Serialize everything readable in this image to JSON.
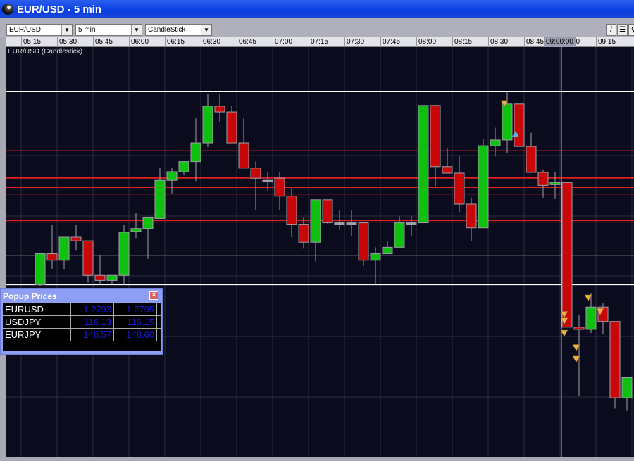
{
  "window": {
    "title": "EUR/USD - 5 min"
  },
  "toolbar": {
    "symbol": "EUR/USD",
    "interval": "5 min",
    "chart_type": "CandleStick",
    "tools": [
      "draw-line-icon",
      "horizontal-lines-icon",
      "zoom-icon"
    ]
  },
  "time_axis": {
    "ticks": [
      "05:15",
      "05:30",
      "05:45",
      "06:00",
      "06:15",
      "06:30",
      "06:45",
      "07:00",
      "07:15",
      "07:30",
      "07:45",
      "08:00",
      "08:15",
      "08:30",
      "08:45",
      "09:00",
      "09:15"
    ],
    "cursor_time": "09:00:00"
  },
  "chart": {
    "label": "EUR/USD (Candlestick)"
  },
  "popup": {
    "title": "Popup Prices",
    "rows": [
      {
        "symbol": "EURUSD",
        "bid": "1.2793",
        "ask": "1.2795"
      },
      {
        "symbol": "USDJPY",
        "bid": "116.13",
        "ask": "116.15"
      },
      {
        "symbol": "EURJPY",
        "bid": "148.57",
        "ask": "148.60"
      }
    ]
  },
  "colors": {
    "up": "#10c010",
    "down": "#c80808",
    "bg": "#0a0b1c",
    "level": "#e02020",
    "marker_sell": "#f0b040",
    "marker_buy": "#60b0f0"
  },
  "chart_data": {
    "type": "candlestick",
    "title": "EUR/USD (Candlestick)",
    "interval_minutes": 5,
    "first_candle_time": "05:20",
    "ylim": [
      -50,
      520
    ],
    "ohlc": [
      [
        190,
        233,
        233,
        188
      ],
      [
        233,
        224,
        273,
        212
      ],
      [
        224,
        256,
        256,
        212
      ],
      [
        256,
        251,
        273,
        238
      ],
      [
        251,
        203,
        251,
        193
      ],
      [
        203,
        196,
        231,
        190
      ],
      [
        196,
        203,
        203,
        190
      ],
      [
        203,
        263,
        273,
        190
      ],
      [
        264,
        268,
        290,
        255
      ],
      [
        268,
        283,
        283,
        226
      ],
      [
        282,
        335,
        352,
        282
      ],
      [
        335,
        347,
        352,
        317
      ],
      [
        347,
        361,
        361,
        343
      ],
      [
        361,
        387,
        421,
        334
      ],
      [
        387,
        438,
        455,
        381
      ],
      [
        438,
        430,
        455,
        416
      ],
      [
        430,
        387,
        438,
        387
      ],
      [
        387,
        352,
        421,
        352
      ],
      [
        352,
        338,
        361,
        294
      ],
      [
        335,
        335,
        347,
        321
      ],
      [
        338,
        313,
        347,
        294
      ],
      [
        313,
        274,
        324,
        256
      ],
      [
        274,
        249,
        283,
        240
      ],
      [
        249,
        308,
        308,
        222
      ],
      [
        308,
        276,
        308,
        275
      ],
      [
        276,
        276,
        294,
        266
      ],
      [
        276,
        276,
        294,
        258
      ],
      [
        276,
        224,
        276,
        216
      ],
      [
        224,
        233,
        242,
        190
      ],
      [
        233,
        242,
        251,
        233
      ],
      [
        242,
        276,
        285,
        242
      ],
      [
        276,
        276,
        285,
        258
      ],
      [
        276,
        439,
        439,
        276
      ],
      [
        439,
        354,
        439,
        327
      ],
      [
        354,
        345,
        380,
        345
      ],
      [
        345,
        302,
        369,
        291
      ],
      [
        302,
        269,
        311,
        251
      ],
      [
        269,
        383,
        392,
        269
      ],
      [
        383,
        391,
        408,
        368
      ],
      [
        391,
        441,
        457,
        373
      ],
      [
        441,
        382,
        441,
        382
      ],
      [
        382,
        346,
        401,
        346
      ],
      [
        346,
        328,
        350,
        311
      ],
      [
        329,
        332,
        346,
        309
      ],
      [
        332,
        131,
        332,
        131
      ],
      [
        131,
        128,
        148,
        36
      ],
      [
        128,
        159,
        178,
        123
      ],
      [
        159,
        139,
        164,
        122
      ],
      [
        139,
        33,
        139,
        18
      ],
      [
        33,
        61,
        61,
        15
      ]
    ],
    "levels": [
      {
        "value": 458,
        "color": "#ffffff"
      },
      {
        "value": 190,
        "color": "#ffffff"
      },
      {
        "value": 231,
        "color": "#b8b8c8"
      },
      {
        "value": 376,
        "color": "#e02020"
      },
      {
        "value": 339,
        "color": "#e02020"
      },
      {
        "value": 338,
        "color": "#e02020"
      },
      {
        "value": 325,
        "color": "#e02020"
      },
      {
        "value": 316,
        "color": "#e02020"
      },
      {
        "value": 279,
        "color": "#e02020"
      },
      {
        "value": 277,
        "color": "#e02020"
      }
    ],
    "markers": [
      {
        "candle": 39,
        "value": 442,
        "type": "sell"
      },
      {
        "candle": 40,
        "value": 399,
        "type": "buy"
      },
      {
        "candle": 44,
        "value": 149,
        "type": "sell"
      },
      {
        "candle": 44,
        "value": 140,
        "type": "sell"
      },
      {
        "candle": 44,
        "value": 123,
        "type": "sell"
      },
      {
        "candle": 45,
        "value": 103,
        "type": "sell"
      },
      {
        "candle": 45,
        "value": 87,
        "type": "sell"
      },
      {
        "candle": 46,
        "value": 172,
        "type": "sell"
      },
      {
        "candle": 47,
        "value": 153,
        "type": "sell"
      }
    ]
  }
}
